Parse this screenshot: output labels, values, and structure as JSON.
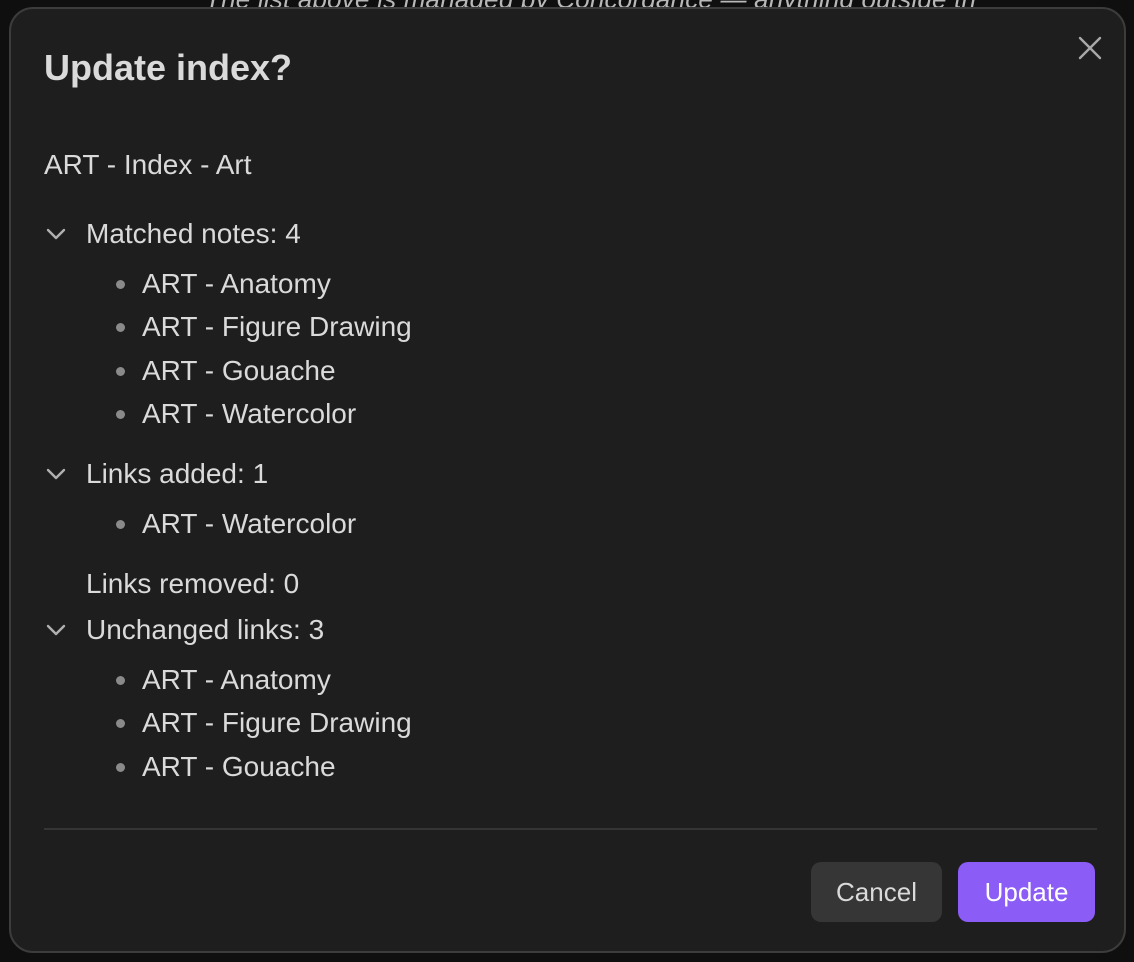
{
  "background": {
    "partial_text": "The list above is managed by Concordance — anything outside th"
  },
  "dialog": {
    "title": "Update index?",
    "index_name": "ART - Index - Art",
    "close_icon": "close-icon",
    "sections": {
      "matched": {
        "label": "Matched notes: 4",
        "expanded": true,
        "items": [
          "ART - Anatomy",
          "ART - Figure Drawing",
          "ART - Gouache",
          "ART - Watercolor"
        ]
      },
      "added": {
        "label": "Links added: 1",
        "expanded": true,
        "items": [
          "ART - Watercolor"
        ]
      },
      "removed": {
        "label": "Links removed: 0"
      },
      "unchanged": {
        "label": "Unchanged links: 3",
        "expanded": true,
        "items": [
          "ART - Anatomy",
          "ART - Figure Drawing",
          "ART - Gouache"
        ]
      }
    },
    "buttons": {
      "cancel": "Cancel",
      "update": "Update"
    }
  },
  "colors": {
    "modal_bg": "#1e1e1e",
    "accent": "#8b5cf6",
    "text": "#dadada"
  }
}
